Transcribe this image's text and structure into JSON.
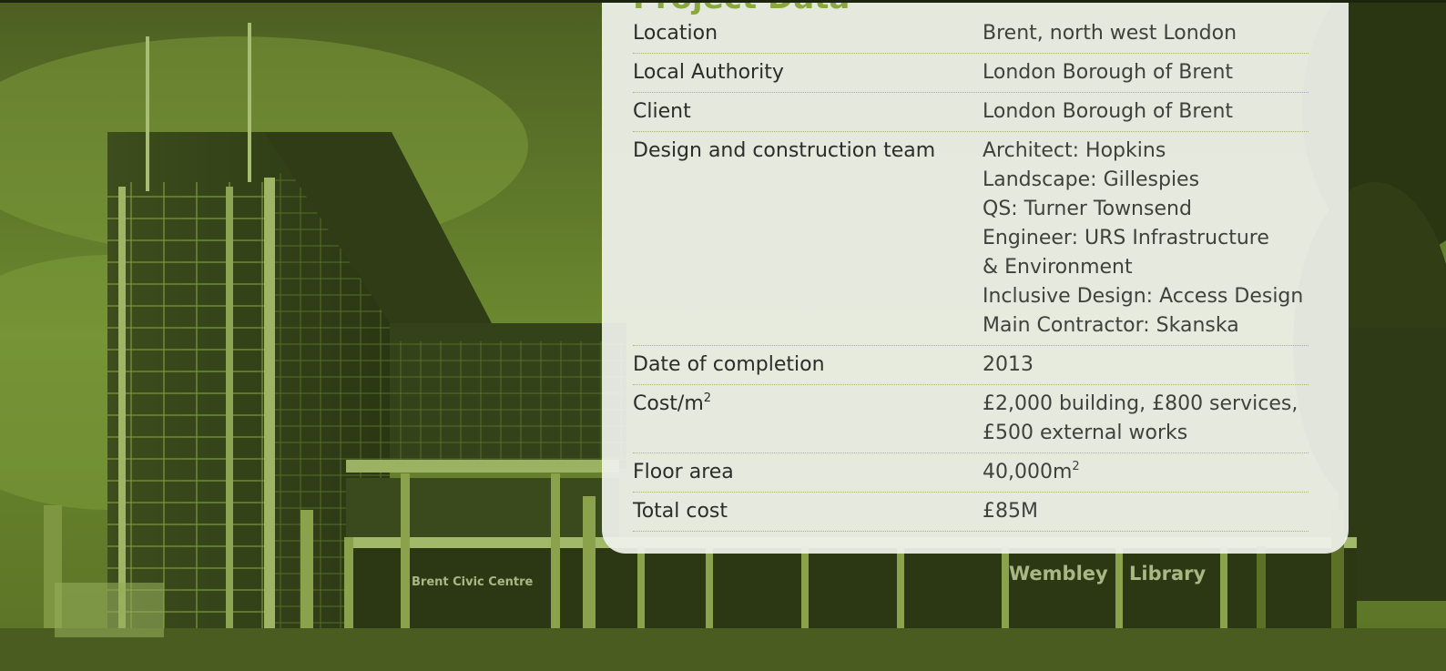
{
  "card": {
    "title": "Project Data",
    "rows": [
      {
        "label": "Location",
        "lines": [
          "Brent, north west London"
        ]
      },
      {
        "label": "Local Authority",
        "lines": [
          "London Borough of Brent"
        ]
      },
      {
        "label": "Client",
        "lines": [
          "London Borough of Brent"
        ]
      },
      {
        "label": "Design and construction team",
        "lines": [
          "Architect: Hopkins",
          "Landscape: Gillespies",
          "QS: Turner Townsend",
          "Engineer: URS Infrastructure",
          "& Environment",
          "Inclusive Design: Access Design",
          "Main Contractor: Skanska"
        ]
      },
      {
        "label": "Date of completion",
        "lines": [
          "2013"
        ]
      },
      {
        "label": "Cost/m",
        "label_sup": "2",
        "lines": [
          "£2,000 building, £800 services,",
          "£500 external works"
        ]
      },
      {
        "label": "Floor area",
        "lines": [
          "40,000m"
        ],
        "value_sup": "2"
      },
      {
        "label": "Total cost",
        "lines": [
          "£85M"
        ]
      }
    ]
  },
  "photo": {
    "sign_left": "Brent Civic Centre",
    "sign_right_1": "Wembley",
    "sign_right_2": "Library"
  },
  "colors": {
    "title": "#8aa93c",
    "tint": "#6e8a2e",
    "rule": "#a8b07e"
  }
}
